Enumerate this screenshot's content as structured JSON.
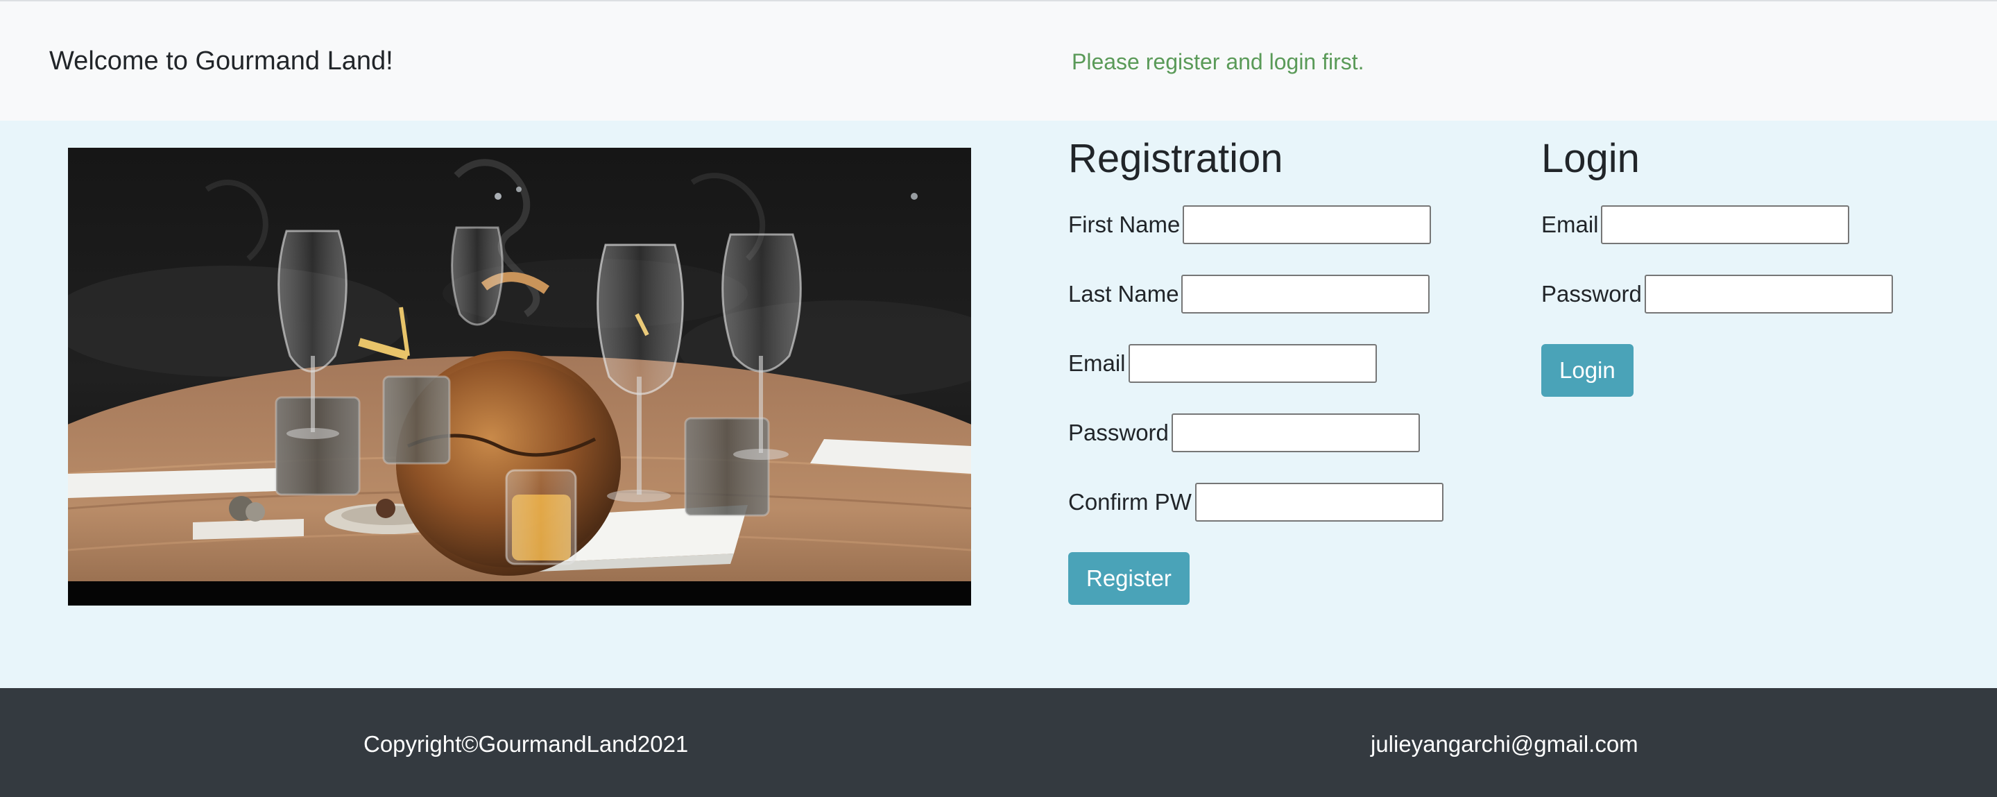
{
  "header": {
    "title": "Welcome to Gourmand Land!",
    "notice": "Please register and login first."
  },
  "registration": {
    "title": "Registration",
    "fields": {
      "first_name": {
        "label": "First Name",
        "value": ""
      },
      "last_name": {
        "label": "Last Name",
        "value": ""
      },
      "email": {
        "label": "Email",
        "value": ""
      },
      "password": {
        "label": "Password",
        "value": ""
      },
      "confirm_pw": {
        "label": "Confirm PW",
        "value": ""
      }
    },
    "submit_label": "Register"
  },
  "login": {
    "title": "Login",
    "fields": {
      "email": {
        "label": "Email",
        "value": ""
      },
      "password": {
        "label": "Password",
        "value": ""
      }
    },
    "submit_label": "Login"
  },
  "footer": {
    "copyright": "Copyright©GourmandLand2021",
    "contact_email": "julieyangarchi@gmail.com"
  },
  "colors": {
    "header_bg": "#f8f9fa",
    "page_bg": "#e8f5fa",
    "notice_text": "#5a9a58",
    "button_bg": "#4aa3b8",
    "footer_bg": "#343a40"
  }
}
